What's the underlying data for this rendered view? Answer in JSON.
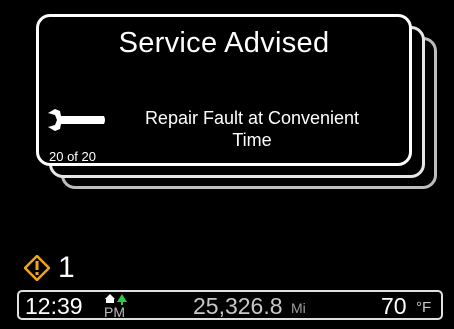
{
  "message_card": {
    "title": "Service Advised",
    "message_line1": "Repair Fault at Convenient",
    "message_line2": "Time",
    "counter": "20 of 20",
    "icon": "wrench-icon"
  },
  "warning": {
    "icon": "warning-diamond-icon",
    "count": "1",
    "color": "#f2a31b"
  },
  "status_bar": {
    "time": "12:39",
    "ampm": "PM",
    "ampm_icon": "sun-tree-icon",
    "odometer": "25,326.8",
    "odometer_unit": "Mi",
    "temperature": "70",
    "temperature_unit": "°F"
  }
}
